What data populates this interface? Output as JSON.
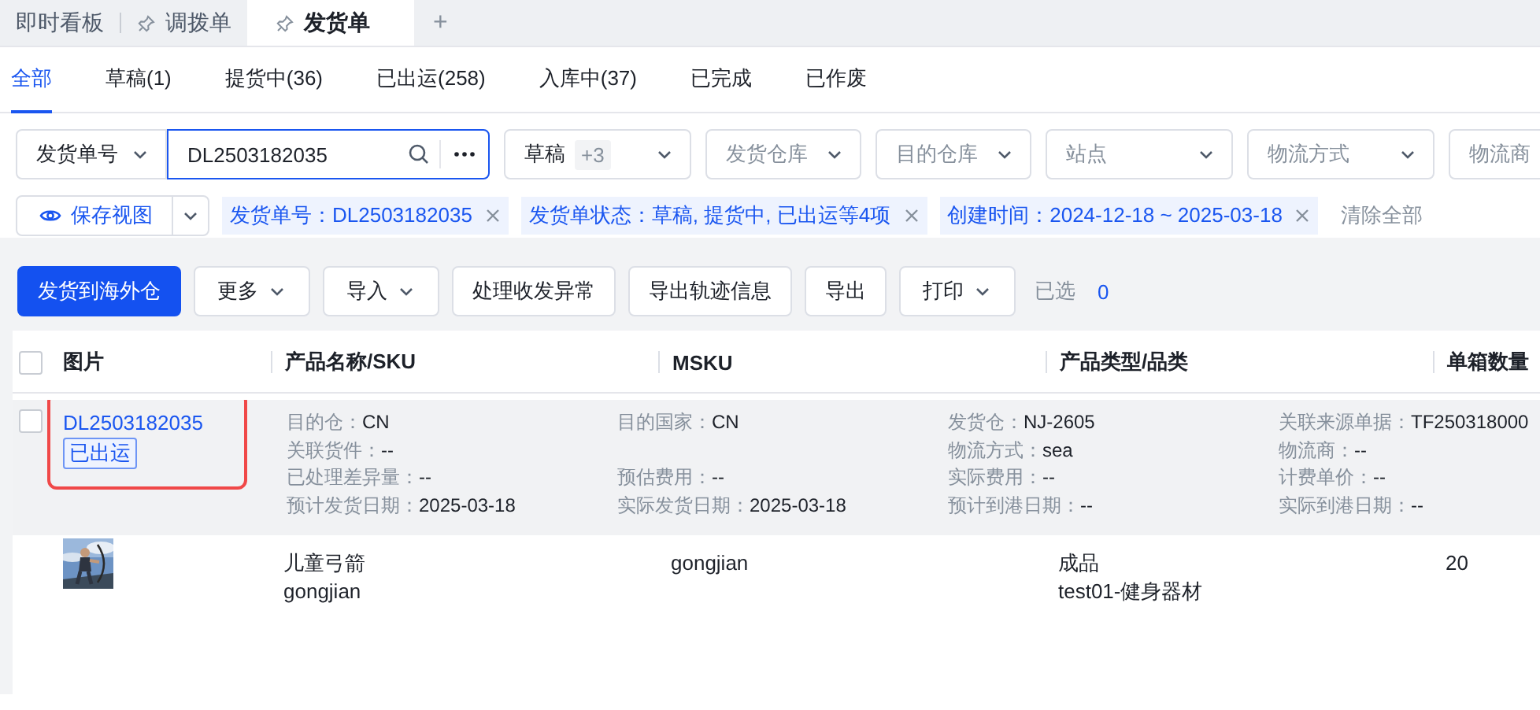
{
  "window_tabs": [
    {
      "label": "即时看板",
      "pinned": false,
      "selected": false
    },
    {
      "label": "调拨单",
      "pinned": true,
      "selected": false
    },
    {
      "label": "发货单",
      "pinned": true,
      "selected": true
    }
  ],
  "new_tab_button": "+",
  "status_tabs": [
    {
      "label": "全部",
      "selected": true
    },
    {
      "label": "草稿(1)",
      "selected": false
    },
    {
      "label": "提货中(36)",
      "selected": false
    },
    {
      "label": "已出运(258)",
      "selected": false
    },
    {
      "label": "入库中(37)",
      "selected": false
    },
    {
      "label": "已完成",
      "selected": false
    },
    {
      "label": "已作废",
      "selected": false
    }
  ],
  "filters": [
    {
      "kind": "select",
      "value": "发货单号"
    },
    {
      "kind": "search",
      "value": "DL2503182035"
    },
    {
      "kind": "multi",
      "value": "草稿",
      "extra": "+3"
    },
    {
      "kind": "select",
      "placeholder": "发货仓库"
    },
    {
      "kind": "select",
      "placeholder": "目的仓库"
    },
    {
      "kind": "select",
      "placeholder": "站点"
    },
    {
      "kind": "select",
      "placeholder": "物流方式"
    },
    {
      "kind": "select",
      "placeholder": "物流商"
    }
  ],
  "save_view_button": "保存视图",
  "chips": [
    {
      "text": "发货单号：DL2503182035"
    },
    {
      "text": "发货单状态：草稿, 提货中, 已出运等4项"
    },
    {
      "text": "创建时间：2024-12-18 ~ 2025-03-18"
    }
  ],
  "clear_all": "清除全部",
  "toolbar": {
    "buttons": [
      {
        "label": "发货到海外仓",
        "kind": "primary"
      },
      {
        "label": "更多",
        "kind": "dropdown"
      },
      {
        "label": "导入",
        "kind": "dropdown"
      },
      {
        "label": "处理收发异常",
        "kind": "plain"
      },
      {
        "label": "导出轨迹信息",
        "kind": "plain"
      },
      {
        "label": "导出",
        "kind": "plain"
      },
      {
        "label": "打印",
        "kind": "dropdown"
      }
    ],
    "selected_label": "已选",
    "selected_count": "0"
  },
  "table": {
    "select_all_checked": false,
    "columns": [
      "图片",
      "产品名称/SKU",
      "MSKU",
      "产品类型/品类",
      "单箱数量"
    ],
    "orders": [
      {
        "checked": false,
        "order_no": "DL2503182035",
        "status": "已出运",
        "highlighted": true,
        "detail_rows": [
          [
            {
              "label": "目的仓：",
              "value": "CN"
            },
            {
              "label": "目的国家：",
              "value": "CN"
            },
            {
              "label": "发货仓：",
              "value": "NJ-2605"
            },
            {
              "label": "关联来源单据：",
              "value": "TF250318000"
            }
          ],
          [
            {
              "label": "关联货件：",
              "value": "--"
            },
            {
              "label": "物流方式：",
              "value": "sea",
              "gap_before": true
            },
            {
              "label": "物流商：",
              "value": "--"
            }
          ],
          [
            {
              "label": "已处理差异量：",
              "value": "--"
            },
            {
              "label": "预估费用：",
              "value": "--"
            },
            {
              "label": "实际费用：",
              "value": "--"
            },
            {
              "label": "计费单价：",
              "value": "--"
            }
          ],
          [
            {
              "label": "预计发货日期：",
              "value": "2025-03-18"
            },
            {
              "label": "实际发货日期：",
              "value": "2025-03-18"
            },
            {
              "label": "预计到港日期：",
              "value": "--"
            },
            {
              "label": "实际到港日期：",
              "value": "--"
            }
          ]
        ],
        "items": [
          {
            "name": "儿童弓箭",
            "sku": "gongjian",
            "msku": "gongjian",
            "type": "成品",
            "category": "test01-健身器材",
            "qty": "20"
          }
        ]
      }
    ]
  }
}
